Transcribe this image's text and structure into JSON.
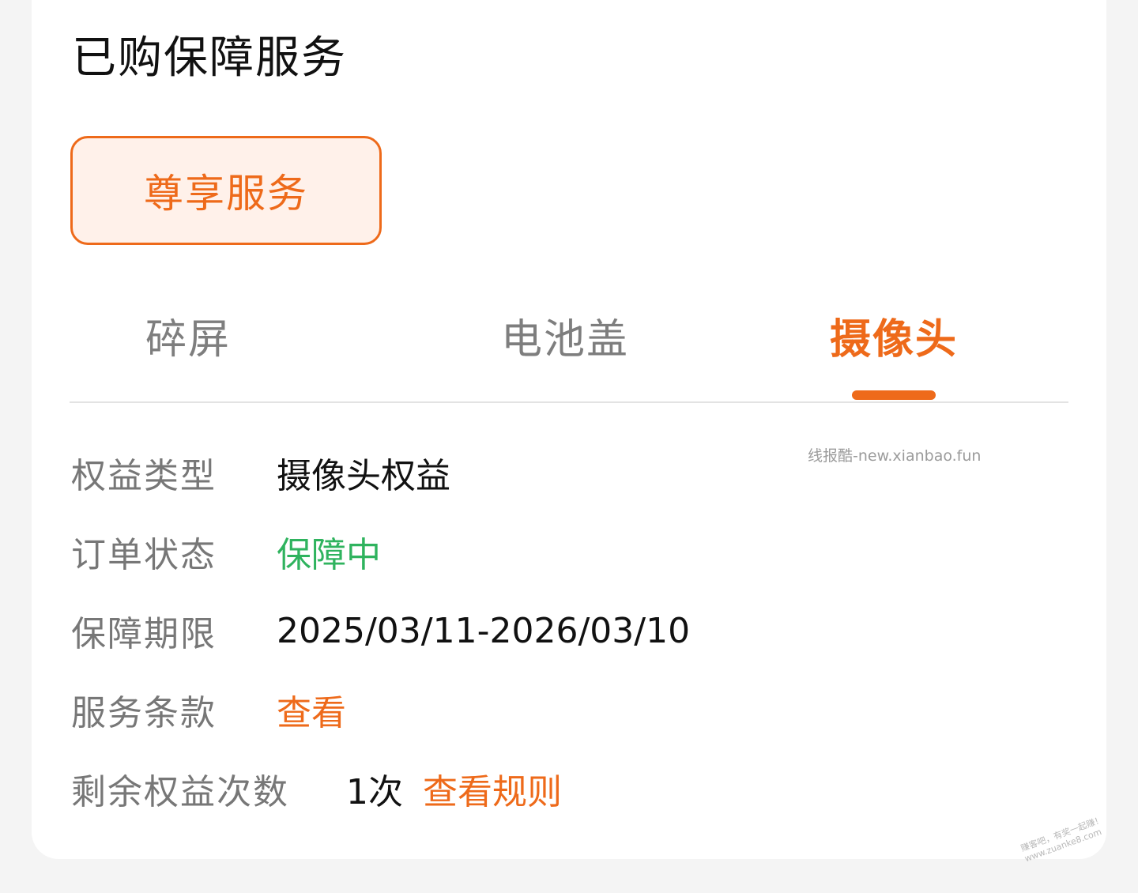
{
  "section": {
    "title": "已购保障服务"
  },
  "service_chip": {
    "label": "尊享服务"
  },
  "tabs": [
    {
      "label": "碎屏",
      "active": false
    },
    {
      "label": "电池盖",
      "active": false
    },
    {
      "label": "摄像头",
      "active": true
    }
  ],
  "details": {
    "type": {
      "label": "权益类型",
      "value": "摄像头权益"
    },
    "status": {
      "label": "订单状态",
      "value": "保障中"
    },
    "period": {
      "label": "保障期限",
      "value": "2025/03/11-2026/03/10"
    },
    "terms": {
      "label": "服务条款",
      "value": "查看"
    },
    "remaining": {
      "label": "剩余权益次数",
      "value": "1次",
      "link": "查看规则"
    }
  },
  "watermark": "线报酷-new.xianbao.fun",
  "corner_watermark": {
    "line1": "赚客吧，有奖一起赚！",
    "line2": "www.zuanke8.com"
  },
  "colors": {
    "accent": "#ee6a1a",
    "accent_bg": "#fff1ea",
    "status_green": "#2fb35e",
    "label_gray": "#777777",
    "page_bg": "#f4f4f4"
  }
}
